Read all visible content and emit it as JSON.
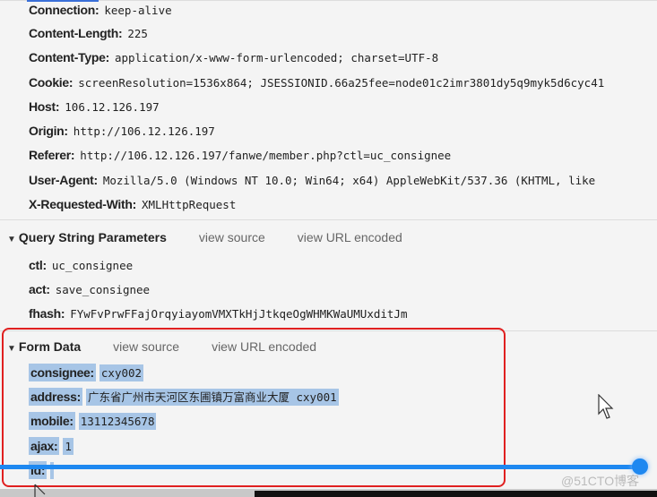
{
  "request_headers": [
    {
      "key": "Connection:",
      "value": "keep-alive"
    },
    {
      "key": "Content-Length:",
      "value": "225"
    },
    {
      "key": "Content-Type:",
      "value": "application/x-www-form-urlencoded; charset=UTF-8"
    },
    {
      "key": "Cookie:",
      "value": "screenResolution=1536x864; JSESSIONID.66a25fee=node01c2imr3801dy5q9myk5d6cyc41"
    },
    {
      "key": "Host:",
      "value": "106.12.126.197"
    },
    {
      "key": "Origin:",
      "value": "http://106.12.126.197"
    },
    {
      "key": "Referer:",
      "value": "http://106.12.126.197/fanwe/member.php?ctl=uc_consignee"
    },
    {
      "key": "User-Agent:",
      "value": "Mozilla/5.0 (Windows NT 10.0; Win64; x64) AppleWebKit/537.36 (KHTML, like"
    },
    {
      "key": "X-Requested-With:",
      "value": "XMLHttpRequest"
    }
  ],
  "query_section": {
    "title": "Query String Parameters",
    "view_source": "view source",
    "view_url_encoded": "view URL encoded",
    "params": [
      {
        "key": "ctl:",
        "value": "uc_consignee"
      },
      {
        "key": "act:",
        "value": "save_consignee"
      },
      {
        "key": "fhash:",
        "value": "FYwFvPrwFFajOrqyiayomVMXTkHjJtkqeOgWHMKWaUMUxditJm"
      }
    ]
  },
  "form_section": {
    "title": "Form Data",
    "view_source": "view source",
    "view_url_encoded": "view URL encoded",
    "params": [
      {
        "key": "consignee:",
        "value": "cxy002"
      },
      {
        "key": "address:",
        "value": "广东省广州市天河区东圃镇万富商业大厦 cxy001"
      },
      {
        "key": "mobile:",
        "value": "13112345678"
      },
      {
        "key": "ajax:",
        "value": "1"
      },
      {
        "key": "id:",
        "value": ""
      }
    ]
  },
  "watermark": "@51CTO博客",
  "colors": {
    "highlight_box": "#e02020",
    "selection": "#a7c5e6",
    "progress": "#1e88f0"
  }
}
